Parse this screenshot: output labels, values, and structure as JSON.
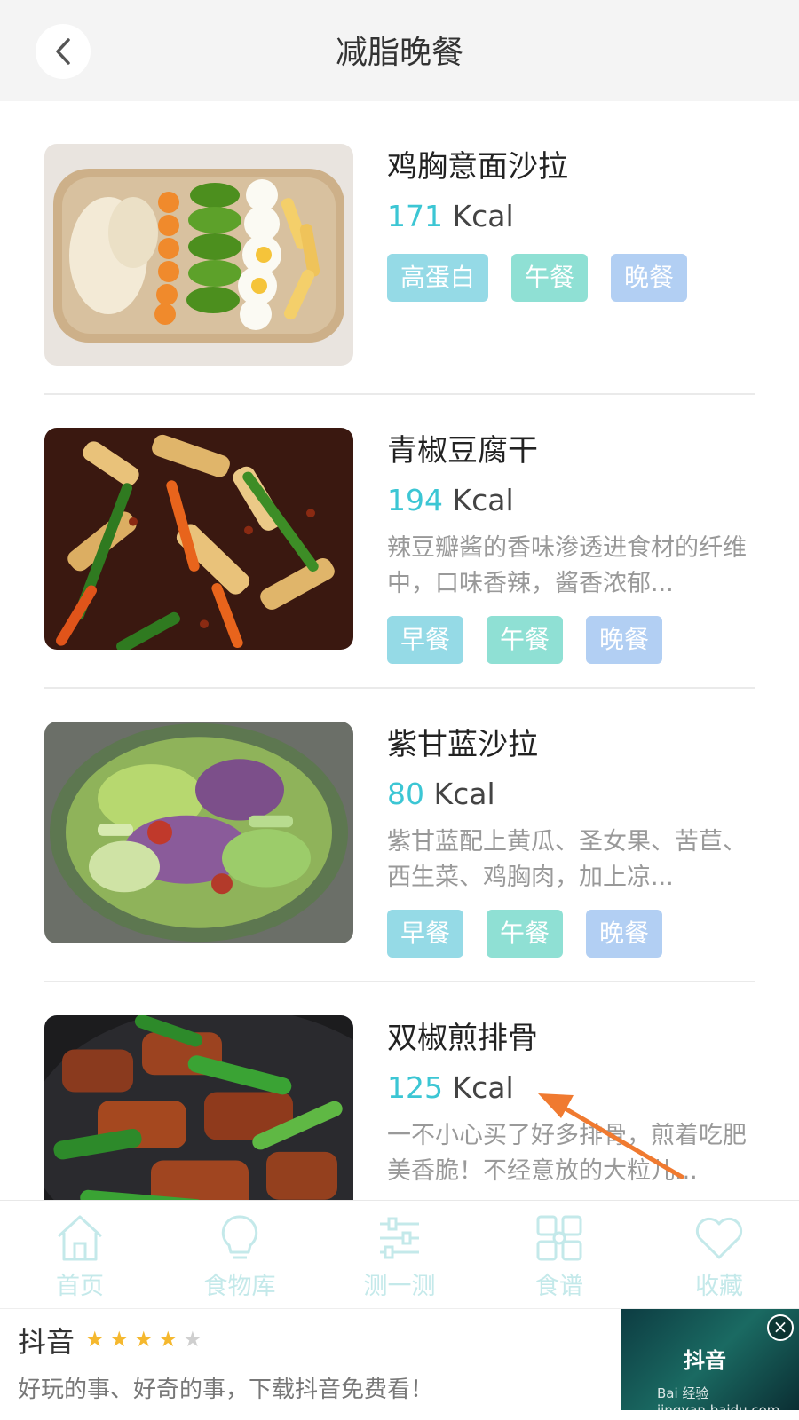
{
  "header": {
    "title": "减脂晚餐",
    "back_icon": "chevron-left-icon"
  },
  "recipes": [
    {
      "name": "鸡胸意面沙拉",
      "kcal_value": "171",
      "kcal_unit": " Kcal",
      "description": "",
      "tags": [
        "高蛋白",
        "午餐",
        "晚餐"
      ]
    },
    {
      "name": "青椒豆腐干",
      "kcal_value": "194",
      "kcal_unit": " Kcal",
      "description": "辣豆瓣酱的香味渗透进食材的纤维中，口味香辣，酱香浓郁...",
      "tags": [
        "早餐",
        "午餐",
        "晚餐"
      ]
    },
    {
      "name": "紫甘蓝沙拉",
      "kcal_value": "80",
      "kcal_unit": " Kcal",
      "description": "紫甘蓝配上黄瓜、圣女果、苦苣、西生菜、鸡胸肉，加上凉...",
      "tags": [
        "早餐",
        "午餐",
        "晚餐"
      ]
    },
    {
      "name": "双椒煎排骨",
      "kcal_value": "125",
      "kcal_unit": " Kcal",
      "description": "一不小心买了好多排骨，煎着吃肥美香脆！不经意放的大粒儿...",
      "tags": []
    }
  ],
  "tabbar": [
    {
      "label": "首页",
      "icon": "home-icon"
    },
    {
      "label": "食物库",
      "icon": "lightbulb-icon"
    },
    {
      "label": "测一测",
      "icon": "sliders-icon"
    },
    {
      "label": "食谱",
      "icon": "grid-icon"
    },
    {
      "label": "收藏",
      "icon": "heart-icon"
    }
  ],
  "ad": {
    "title": "抖音",
    "rating": 4,
    "rating_max": 5,
    "description": "好玩的事、好奇的事，下载抖音免费看！",
    "brand": "抖音",
    "watermark": "Bai 经验 jingyan.baidu.com",
    "close_icon": "close-icon"
  },
  "colors": {
    "accent": "#3cc6d4",
    "tag_blue": "#95dae6",
    "tag_green": "#8fe0d4",
    "tag_purple": "#b2cff3",
    "arrow": "#f07a30"
  }
}
